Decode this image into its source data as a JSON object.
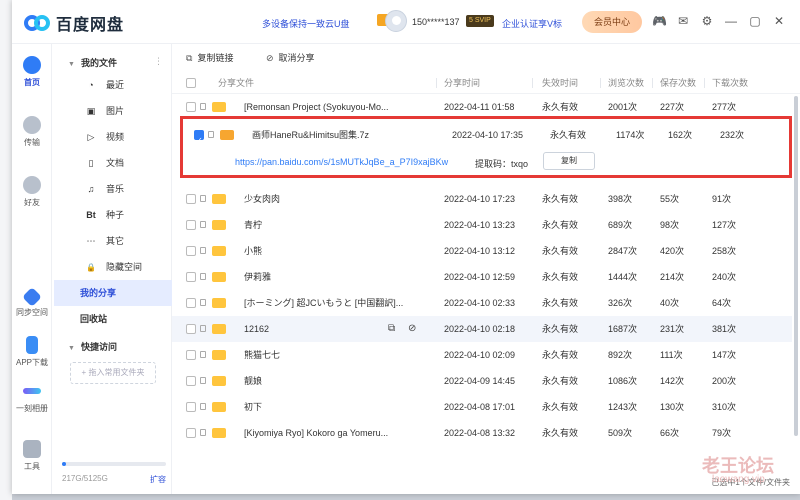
{
  "app": {
    "title": "百度网盘",
    "promo": "多设备保持一致云U盘",
    "username": "150*****137",
    "vip_badge": "5 SVIP",
    "enterprise": "企业认证享V标",
    "member_center": "会员中心"
  },
  "leftnav": [
    {
      "label": "首页"
    },
    {
      "label": "传输"
    },
    {
      "label": "好友"
    },
    {
      "label": "同步空间"
    },
    {
      "label": "APP下载"
    },
    {
      "label": "一刻相册"
    },
    {
      "label": "工具"
    }
  ],
  "sidebar": {
    "my_files": "我的文件",
    "items": [
      {
        "label": "最近",
        "icon": "clock-icon",
        "glyph": "◔"
      },
      {
        "label": "图片",
        "icon": "image-icon",
        "glyph": "▣"
      },
      {
        "label": "视频",
        "icon": "video-icon",
        "glyph": "▷"
      },
      {
        "label": "文档",
        "icon": "document-icon",
        "glyph": "▯"
      },
      {
        "label": "音乐",
        "icon": "music-icon",
        "glyph": "♫"
      },
      {
        "label": "种子",
        "icon": "bt-icon",
        "glyph": "Bt"
      },
      {
        "label": "其它",
        "icon": "more-icon",
        "glyph": "⋯"
      },
      {
        "label": "隐藏空间",
        "icon": "lock-icon",
        "glyph": "🔒"
      }
    ],
    "my_share": "我的分享",
    "recycle": "回收站",
    "quick_access": "快捷访问",
    "add_common": "+ 拖入常用文件夹",
    "storage_text": "217G/5125G",
    "storage_fraction": 0.04,
    "expand": "扩容"
  },
  "toolbar": {
    "copy_link": "复制链接",
    "cancel_share": "取消分享"
  },
  "table": {
    "headers": {
      "name": "分享文件",
      "time": "分享时间",
      "expire": "失效时间",
      "views": "浏览次数",
      "saves": "保存次数",
      "downloads": "下载次数"
    },
    "rows": [
      {
        "name": "[Remonsan Project (Syokuyou-Mo...",
        "time": "2022-04-11 01:58",
        "expire": "永久有效",
        "views": "2001次",
        "saves": "227次",
        "downloads": "277次"
      },
      {
        "name": "画师HaneRu&Himitsu图集.7z",
        "time": "2022-04-10 17:35",
        "expire": "永久有效",
        "views": "1174次",
        "saves": "162次",
        "downloads": "232次",
        "link": "https://pan.baidu.com/s/1sMUTkJqBe_a_P7I9xajBKw",
        "code": "提取码：txqo",
        "copy": "复制"
      },
      {
        "name": "少女肉肉",
        "time": "2022-04-10 17:23",
        "expire": "永久有效",
        "views": "398次",
        "saves": "55次",
        "downloads": "91次"
      },
      {
        "name": "青柠",
        "time": "2022-04-10 13:23",
        "expire": "永久有效",
        "views": "689次",
        "saves": "98次",
        "downloads": "127次"
      },
      {
        "name": "小熊",
        "time": "2022-04-10 13:12",
        "expire": "永久有效",
        "views": "2847次",
        "saves": "420次",
        "downloads": "258次"
      },
      {
        "name": "伊莉雅",
        "time": "2022-04-10 12:59",
        "expire": "永久有效",
        "views": "1444次",
        "saves": "214次",
        "downloads": "240次"
      },
      {
        "name": "[ホーミング] 超JCいもうと [中国翻訳]...",
        "time": "2022-04-10 02:33",
        "expire": "永久有效",
        "views": "326次",
        "saves": "40次",
        "downloads": "64次"
      },
      {
        "name": "12162",
        "time": "2022-04-10 02:18",
        "expire": "永久有效",
        "views": "1687次",
        "saves": "231次",
        "downloads": "381次"
      },
      {
        "name": "熊猫七七",
        "time": "2022-04-10 02:09",
        "expire": "永久有效",
        "views": "892次",
        "saves": "111次",
        "downloads": "147次"
      },
      {
        "name": "靓娘",
        "time": "2022-04-09 14:45",
        "expire": "永久有效",
        "views": "1086次",
        "saves": "142次",
        "downloads": "200次"
      },
      {
        "name": "初下",
        "time": "2022-04-08 17:01",
        "expire": "永久有效",
        "views": "1243次",
        "saves": "130次",
        "downloads": "310次"
      },
      {
        "name": "[Kiyomiya Ryo] Kokoro ga Yomeru...",
        "time": "2022-04-08 13:32",
        "expire": "永久有效",
        "views": "509次",
        "saves": "66次",
        "downloads": "79次"
      }
    ]
  },
  "status": "已选中1个文件/文件夹",
  "watermark": {
    "cn": "老王论坛",
    "en": "laowang.vip"
  },
  "colors": {
    "accent": "#2f50d8",
    "highlight_border": "#e53935",
    "folder": "#ffc53d"
  }
}
